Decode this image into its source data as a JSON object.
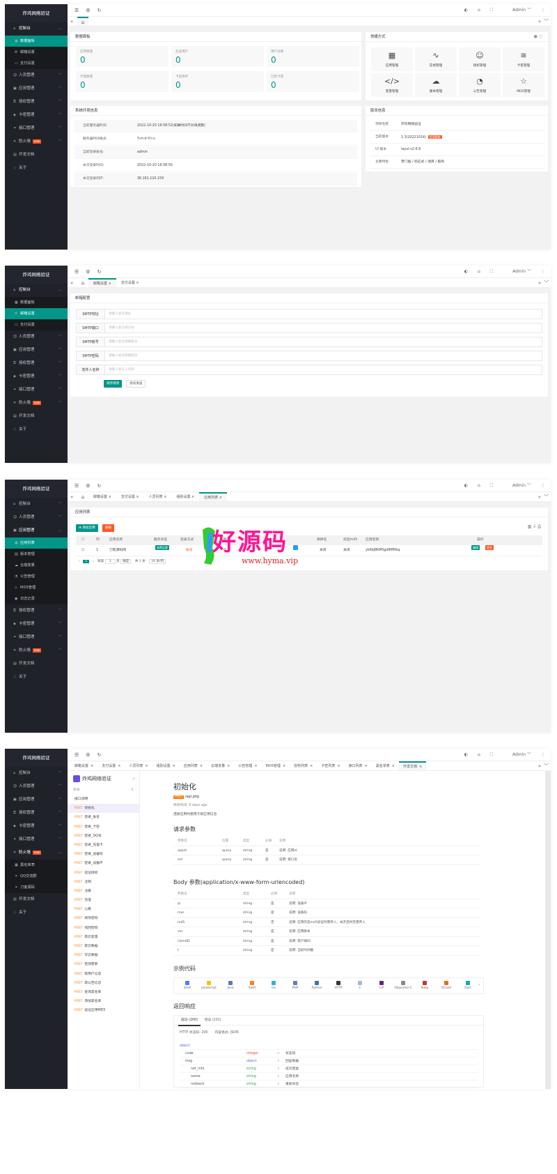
{
  "app_title": "炸鸡网络验证",
  "user": "Admin",
  "sidebar": {
    "console": "控制台",
    "dashboard": "数据面板",
    "mail": "邮箱设置",
    "pay": "支付设置",
    "people": "人员管理",
    "apps": "应用管理",
    "auth": "授权管理",
    "cards": "卡密管理",
    "api": "接口管理",
    "firewall": "防火墙",
    "new": "new",
    "dev": "开发文档",
    "about": "关于",
    "app_list": "应用列表",
    "version": "版本管理",
    "cloud_var": "云端变量",
    "notice": "公告管理",
    "md5": "MD5管理",
    "log": "日志记录",
    "blacklist": "黑名单表",
    "qq": "QQ交流群",
    "dao": "刀客源码"
  },
  "tabs": {
    "mail": "邮箱设置",
    "pay": "支付设置",
    "people": "人员列表",
    "group": "组别设置",
    "apps": "应用列表",
    "cloud": "云端变量",
    "notice": "公告管理",
    "md5": "MD5管理",
    "auth": "授权列表",
    "cards": "卡密列表",
    "api": "接口列表",
    "black": "黑名单表",
    "dev": "开发文档",
    "close": "×"
  },
  "dash": {
    "panel_title": "数据面板",
    "stats": [
      {
        "label": "应用数量",
        "value": "0"
      },
      {
        "label": "在线用户",
        "value": "0"
      },
      {
        "label": "用户总数",
        "value": "0"
      },
      {
        "label": "代理数量",
        "value": "0"
      },
      {
        "label": "卡密库存",
        "value": "0"
      },
      {
        "label": "已售卡密",
        "value": "0"
      }
    ],
    "quick_title": "快捷方式",
    "quick": [
      {
        "icon": "▦",
        "label": "应用管理"
      },
      {
        "icon": "∿",
        "label": "在线管理"
      },
      {
        "icon": "☺",
        "label": "授权管理"
      },
      {
        "icon": "≋",
        "label": "卡密管理"
      },
      {
        "icon": "</>",
        "label": "变量管理"
      },
      {
        "icon": "☁",
        "label": "版本管理"
      },
      {
        "icon": "◔",
        "label": "公告管理"
      },
      {
        "icon": "☆",
        "label": "MD5管理"
      }
    ],
    "env_title": "系统环境信息",
    "env": [
      {
        "k": "当前服务器时间:",
        "v": "2022-10-20 16:58:52(如果时间不对请调整)"
      },
      {
        "k": "服务器时间格式:",
        "v": "Y-m-d H:i:s"
      },
      {
        "k": "当前登录账号:",
        "v": "admin"
      },
      {
        "k": "本次登录时间:",
        "v": "2022-10-20 16:58:50"
      },
      {
        "k": "本次登录的IP:",
        "v": "36.161.210.159"
      }
    ],
    "ver_title": "版本信息",
    "ver": [
      {
        "k": "项目名称",
        "v": "炸鸡网络验证"
      },
      {
        "k": "当前版本",
        "v": "1.3(20221014)",
        "tag": "检测更新"
      },
      {
        "k": "UI 版本",
        "v": "layui-v2.6.8"
      },
      {
        "k": "主要特色",
        "v": "零门槛 / 响应式 / 清爽 / 极简"
      }
    ]
  },
  "mail": {
    "title": "邮箱配置",
    "fields": [
      {
        "label": "SMTP地址",
        "ph": "请输入发信地址"
      },
      {
        "label": "SMTP端口",
        "ph": "请输入发信端口号"
      },
      {
        "label": "SMTP账号",
        "ph": "请输入发信邮箱账号"
      },
      {
        "label": "SMTP密码",
        "ph": "请输入发信邮箱密码"
      },
      {
        "label": "发件人名称",
        "ph": "请输入发信人名称"
      }
    ],
    "save": "保存修改",
    "test": "测试发送"
  },
  "apps": {
    "title": "应用列表",
    "add": "⊕ 添加应用",
    "del": "删除",
    "cols": [
      "ID",
      "应用名称",
      "服务状态",
      "登录方式",
      "时",
      "方式",
      "",
      "换绑名",
      "校验md5",
      "应用密钥",
      "操作"
    ],
    "row": {
      "id": "1",
      "name": "刀客源码网",
      "status": "收费运营",
      "login": "账号",
      "p1": "0",
      "p2": "",
      "p3": "关闭",
      "md5": "关闭",
      "key": "yk6bJ8KMSgd8MMsq",
      "edit": "编辑",
      "more": "更多"
    },
    "pager": {
      "page": "1",
      "to": "到第",
      "p": "1",
      "unit": "页",
      "ok": "确定",
      "total": "共 1 条",
      "size": "10 条/页"
    }
  },
  "watermark": {
    "text": "好源码",
    "url": "www.hyma.vip"
  },
  "doc": {
    "title": "炸鸡网络验证",
    "dir": "目录",
    "intro": "接口说明",
    "method": "POST",
    "apis": [
      "初始化",
      "登录_账号",
      "登录_卡密",
      "登录_QQ号",
      "登录_充值卡",
      "登录_设备码",
      "登录_设备IP",
      "验证授权",
      "注销",
      "注册",
      "充值",
      "心跳",
      "修改密码",
      "找回密码",
      "取云变量",
      "取云数据",
      "写云数据",
      "检测更新",
      "取用户信息",
      "取公告信息",
      "查询黑名单",
      "添加黑名单",
      "验证应用MD5"
    ],
    "api_title": "初始化",
    "path": "/api.php",
    "modified": "修改时间: 6 days ago",
    "desc": "连接应用时使用于取应用信息",
    "req_title": "请求参数",
    "req_head": [
      "参数名",
      "位置",
      "类型",
      "必填",
      "说明"
    ],
    "req_rows": [
      [
        "appid",
        "query",
        "string",
        "是",
        "说明: 应用id"
      ],
      [
        "act",
        "query",
        "string",
        "是",
        "说明: 接口名"
      ]
    ],
    "body_title": "Body 参数(application/x-www-form-urlencoded)",
    "body_head": [
      "参数名",
      "类型",
      "必填",
      "说明"
    ],
    "body_rows": [
      [
        "ip",
        "string",
        "是",
        "说明: 设备IP"
      ],
      [
        "mac",
        "string",
        "是",
        "说明: 设备码"
      ],
      [
        "md5",
        "string",
        "否",
        "说明: 应用开启md5验证时需传入，关开启时无需传入"
      ],
      [
        "ver",
        "string",
        "是",
        "说明: 应用版本"
      ],
      [
        "clientID",
        "string",
        "是",
        "说明: 客户端ID"
      ],
      [
        "t",
        "string",
        "是",
        "说明: 当前时间戳"
      ]
    ],
    "code_title": "示例代码",
    "langs": [
      "Shell",
      "JavaScript",
      "Java",
      "Swift",
      "Go",
      "PHP",
      "Python",
      "HTTP",
      "C",
      "C#",
      "Objective-C",
      "Ruby",
      "OCaml",
      "Dart"
    ],
    "lang_colors": [
      "#4a7cff",
      "#f5c400",
      "#5a7fa8",
      "#ff7a2f",
      "#26b5e0",
      "#6c7ab4",
      "#3b73a8",
      "#333333",
      "#a8b9cc",
      "#68217a",
      "#888888",
      "#cc342d",
      "#ee6a1a",
      "#00b4ab"
    ],
    "resp_title": "返回响应",
    "resp_tabs": [
      "成功 (200)",
      "错误 (201)"
    ],
    "http": "HTTP 状态码: 200",
    "fmt": "内容格式: JSON",
    "schema": [
      {
        "n": "object",
        "t": "",
        "d": ""
      },
      {
        "n": "code",
        "t": "integer",
        "d": "状态码"
      },
      {
        "n": "msg",
        "t": "object",
        "d": "回复数据"
      },
      {
        "n": "net_info",
        "t": "string",
        "d": "成功回复"
      },
      {
        "n": "name",
        "t": "string",
        "d": "应用名称"
      },
      {
        "n": "notback",
        "t": "string",
        "d": "重新状态"
      }
    ]
  }
}
